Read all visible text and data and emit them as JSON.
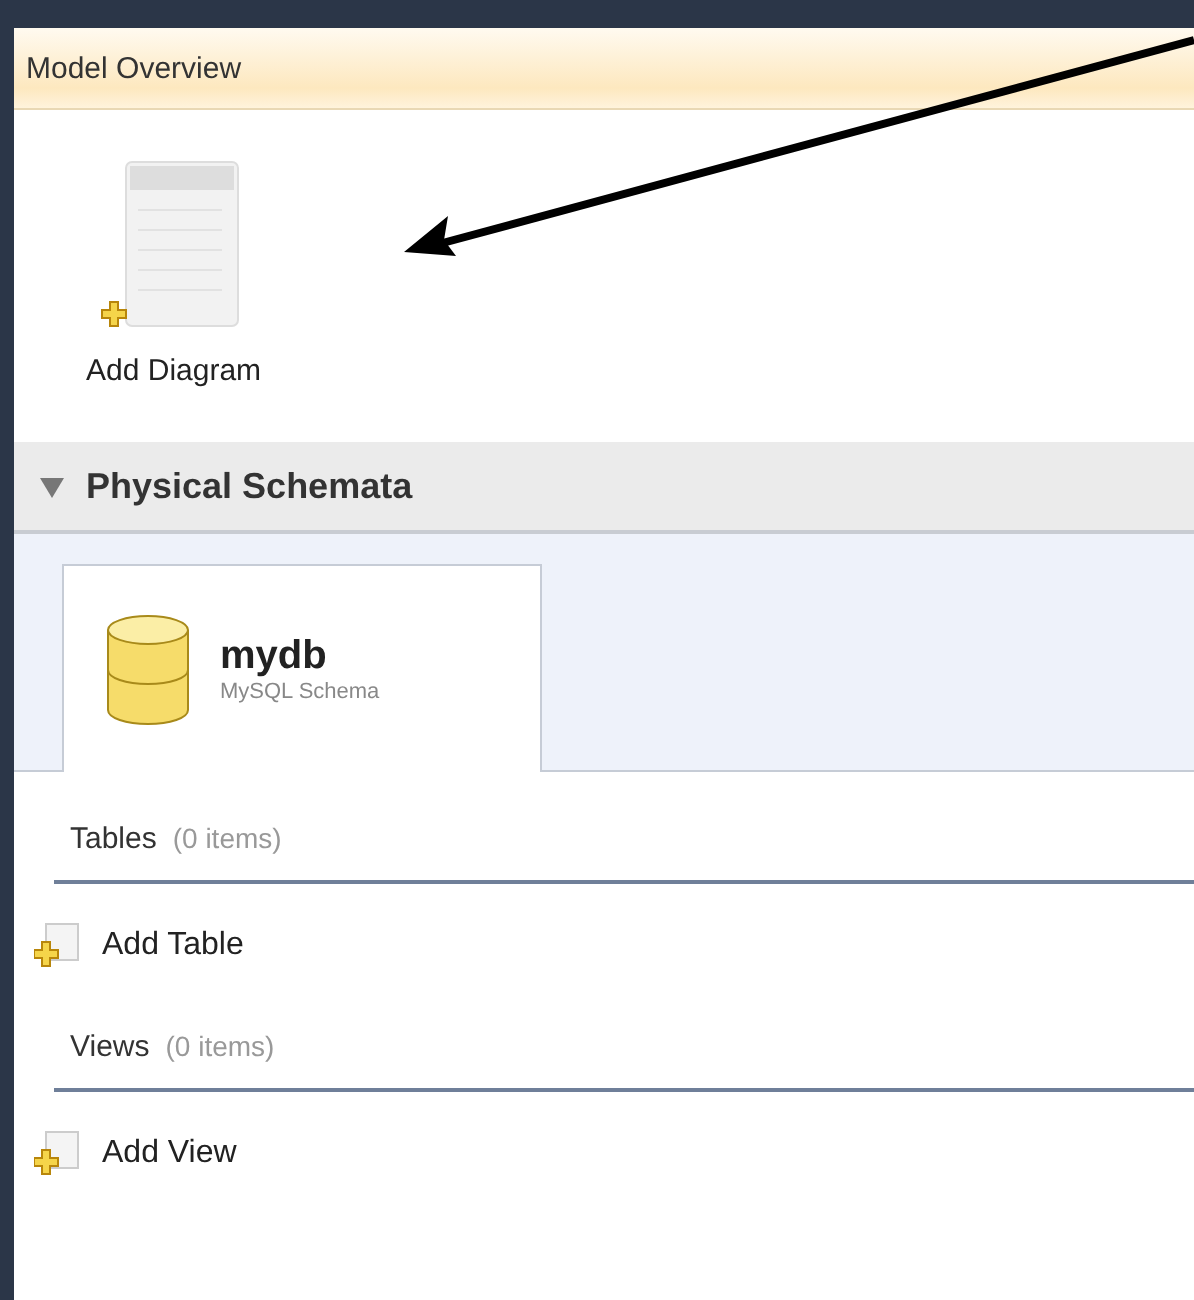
{
  "panel": {
    "title": "Model Overview"
  },
  "diagram_action": {
    "label": "Add Diagram"
  },
  "section": {
    "title": "Physical Schemata",
    "expanded": true
  },
  "schemas": [
    {
      "name": "mydb",
      "subtitle": "MySQL Schema",
      "selected": true
    }
  ],
  "groups": [
    {
      "title": "Tables",
      "count": "(0 items)",
      "action": "Add Table"
    },
    {
      "title": "Views",
      "count": "(0 items)",
      "action": "Add View"
    }
  ]
}
